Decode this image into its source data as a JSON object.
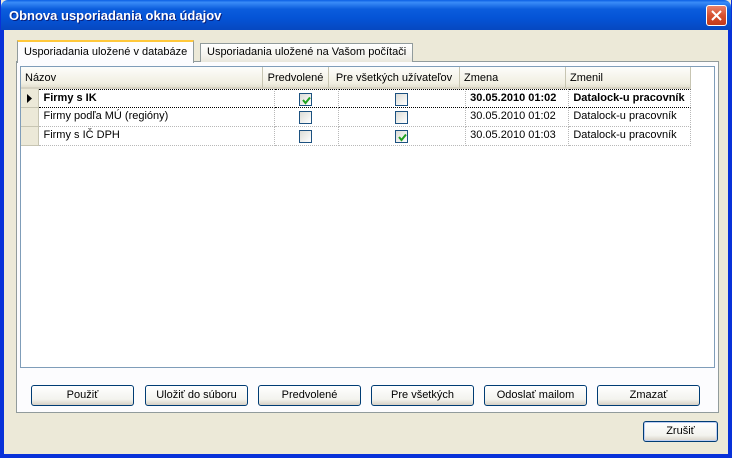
{
  "window": {
    "title": "Obnova usporiadania okna údajov"
  },
  "tabs": [
    {
      "label": "Usporiadania uložené v databáze",
      "active": true
    },
    {
      "label": "Usporiadania uložené na Vašom počítači",
      "active": false
    }
  ],
  "grid": {
    "columns": [
      "Názov",
      "Predvolené",
      "Pre všetkých užívateľov",
      "Zmena",
      "Zmenil"
    ],
    "rows": [
      {
        "name": "Firmy s IK",
        "default": true,
        "all_users": false,
        "changed": "30.05.2010 01:02",
        "changed_by": "Datalock-u pracovník",
        "current": true,
        "bold": true
      },
      {
        "name": "Firmy podľa MÚ (regióny)",
        "default": false,
        "all_users": false,
        "changed": "30.05.2010 01:02",
        "changed_by": "Datalock-u pracovník",
        "current": false,
        "bold": false
      },
      {
        "name": "Firmy s IČ DPH",
        "default": false,
        "all_users": true,
        "changed": "30.05.2010 01:03",
        "changed_by": "Datalock-u pracovník",
        "current": false,
        "bold": false
      }
    ]
  },
  "buttons": {
    "apply": "Použiť",
    "save_file": "Uložiť do súboru",
    "default": "Predvolené",
    "for_all": "Pre všetkých",
    "send_mail": "Odoslať mailom",
    "delete": "Zmazať",
    "cancel": "Zrušiť"
  },
  "colors": {
    "title_bar": "#0554d6",
    "check": "#21a121",
    "tab_highlight": "#ffc83c"
  },
  "icons": {
    "close": "close-icon",
    "row_pointer": "row-pointer-icon",
    "check": "check-icon"
  }
}
